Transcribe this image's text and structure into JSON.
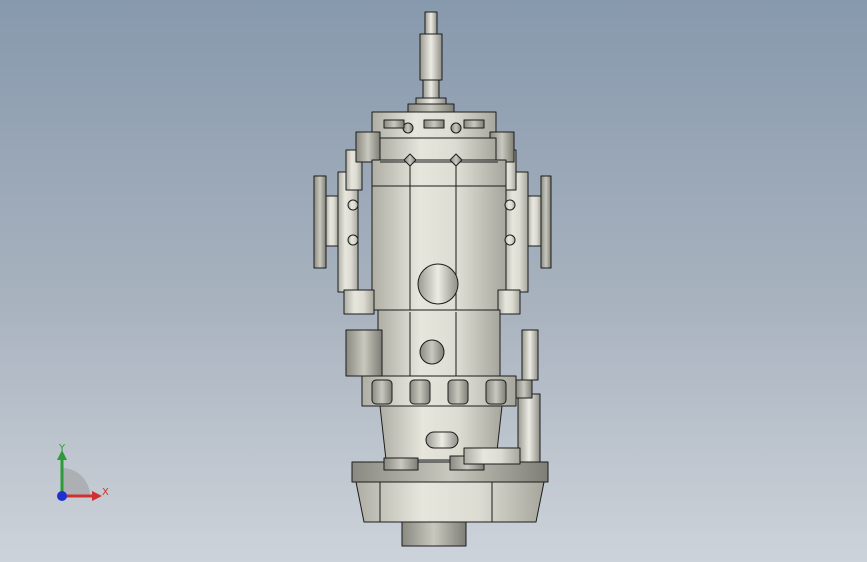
{
  "viewport": {
    "background_top": "#8799ad",
    "background_bottom": "#cdd3da",
    "model_label": "gearbox-assembly",
    "shade_color": "#d9d9cf",
    "edge_color": "#1c1c1c"
  },
  "triad": {
    "x_label": "X",
    "y_label": "Y",
    "x_color": "#d03030",
    "y_color": "#2f9a3a",
    "z_color": "#2030d0"
  }
}
